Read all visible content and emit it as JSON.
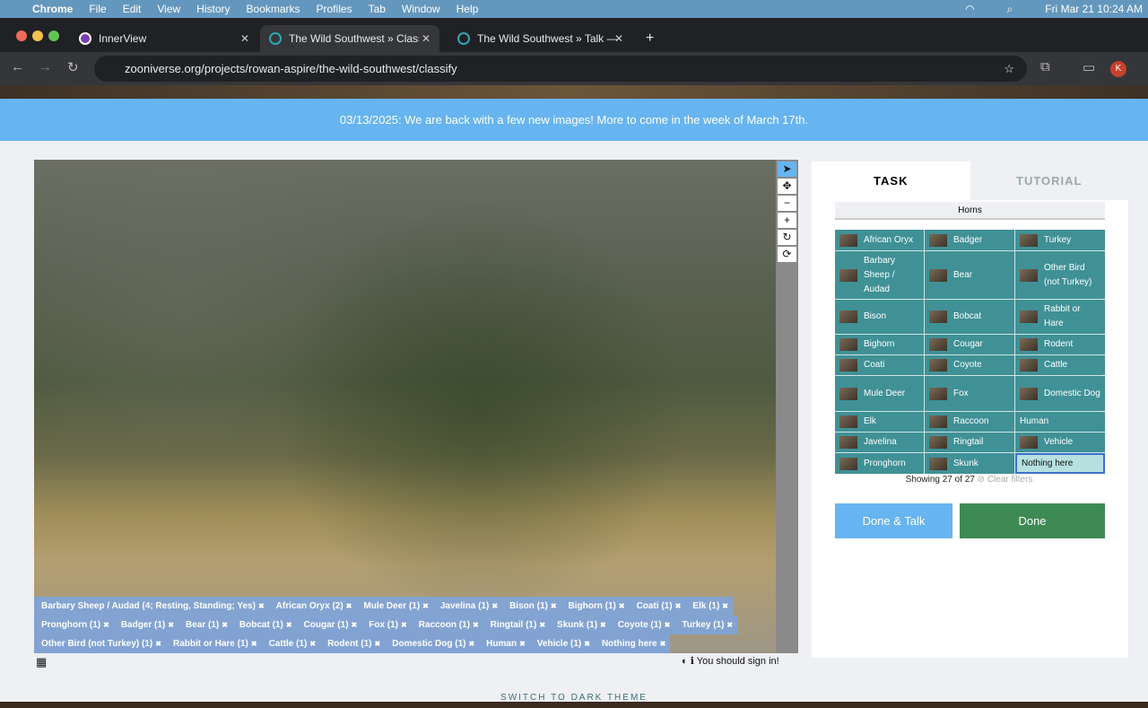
{
  "menubar": {
    "app": "Chrome",
    "items": [
      "File",
      "Edit",
      "View",
      "History",
      "Bookmarks",
      "Profiles",
      "Tab",
      "Window",
      "Help"
    ],
    "clock": "Fri Mar 21  10:24 AM"
  },
  "tabs": [
    {
      "label": "InnerView"
    },
    {
      "label": "The Wild Southwest » Classify"
    },
    {
      "label": "The Wild Southwest » Talk —"
    }
  ],
  "address": {
    "url": "zooniverse.org/projects/rowan-aspire/the-wild-southwest/classify",
    "avatar": "K"
  },
  "banner": "03/13/2025: We are back with a few new images! More to come in the week of March 17th.",
  "chips": [
    "Barbary Sheep / Audad (4; Resting, Standing; Yes)",
    "African Oryx (2)",
    "Mule Deer (1)",
    "Javelina (1)",
    "Bison (1)",
    "Bighorn (1)",
    "Coati (1)",
    "Elk (1)",
    "Pronghorn (1)",
    "Badger (1)",
    "Bear (1)",
    "Bobcat (1)",
    "Cougar (1)",
    "Fox (1)",
    "Raccoon (1)",
    "Ringtail (1)",
    "Skunk (1)",
    "Coyote (1)",
    "Turkey (1)",
    "Other Bird (not Turkey) (1)",
    "Rabbit or Hare (1)",
    "Cattle (1)",
    "Rodent (1)",
    "Domestic Dog (1)",
    "Human",
    "Vehicle (1)",
    "Nothing here"
  ],
  "tools": [
    "pointer-icon",
    "move-icon",
    "zoom-out-icon",
    "zoom-in-icon",
    "rotate-icon",
    "reset-icon"
  ],
  "sign_in": "You should sign in!",
  "panel": {
    "tabs": [
      "TASK",
      "TUTORIAL"
    ],
    "filter": "Horns",
    "choices": [
      "African Oryx",
      "Badger",
      "Turkey",
      "Barbary Sheep / Audad",
      "Bear",
      "Other Bird (not Turkey)",
      "Bison",
      "Bobcat",
      "Rabbit or Hare",
      "Bighorn",
      "Cougar",
      "Rodent",
      "Coati",
      "Coyote",
      "Cattle",
      "Mule Deer",
      "Fox",
      "Domestic Dog",
      "Elk",
      "Raccoon",
      "Human",
      "Javelina",
      "Ringtail",
      "Vehicle",
      "Pronghorn",
      "Skunk",
      "Nothing here"
    ],
    "showing": "Showing 27 of 27",
    "clear": "Clear filters",
    "done_talk": "Done & Talk",
    "done": "Done"
  },
  "footer": {
    "theme": "SWITCH TO DARK THEME"
  },
  "colors": {
    "teal": "#3f9196",
    "done": "#3e8a54",
    "talk": "#66b4f0"
  }
}
